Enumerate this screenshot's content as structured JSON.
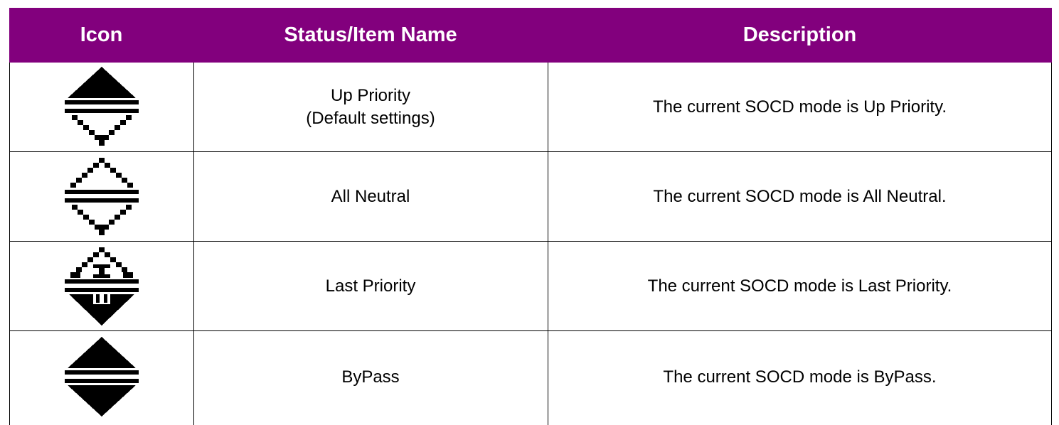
{
  "header": {
    "col_icon": "Icon",
    "col_name": "Status/Item Name",
    "col_desc": "Description"
  },
  "rows": [
    {
      "icon": "up-priority-icon",
      "name_line1": "Up Priority",
      "name_line2": "(Default settings)",
      "description": "The current SOCD mode is Up Priority."
    },
    {
      "icon": "all-neutral-icon",
      "name_line1": "All Neutral",
      "description": "The current SOCD mode is All Neutral."
    },
    {
      "icon": "last-priority-icon",
      "name_line1": "Last Priority",
      "description": "The current SOCD mode is Last Priority."
    },
    {
      "icon": "bypass-icon",
      "name_line1": "ByPass",
      "description": "The current SOCD mode is ByPass."
    }
  ],
  "colors": {
    "header_bg": "#82007d",
    "header_text": "#ffffff",
    "grid": "#000000"
  }
}
